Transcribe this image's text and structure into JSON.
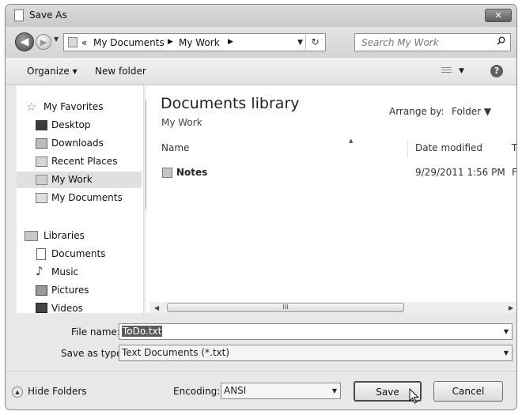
{
  "window": {
    "title": "Save As",
    "close_label": "✕"
  },
  "nav": {
    "back_label": "◀",
    "forward_label": "▶",
    "address": {
      "overflow": "«",
      "crumbs": [
        "My Documents",
        "My Work"
      ],
      "separator": "▶",
      "refresh": "↻"
    },
    "search_placeholder": "Search My Work"
  },
  "toolbar": {
    "organize": "Organize ▾",
    "new_folder": "New folder",
    "view_dd": "▼",
    "help": "?"
  },
  "sidebar": {
    "favorites": [
      {
        "label": "My Favorites",
        "icon": "star-icon"
      },
      {
        "label": "Desktop",
        "icon": "desktop-icon"
      },
      {
        "label": "Downloads",
        "icon": "downloads-icon"
      },
      {
        "label": "Recent Places",
        "icon": "recent-places-icon"
      },
      {
        "label": "My Work",
        "icon": "folder-icon",
        "selected": true
      },
      {
        "label": "My Documents",
        "icon": "documents-icon"
      }
    ],
    "libraries": [
      {
        "label": "Libraries",
        "icon": "libraries-icon"
      },
      {
        "label": "Documents",
        "icon": "document-icon"
      },
      {
        "label": "Music",
        "icon": "music-icon"
      },
      {
        "label": "Pictures",
        "icon": "pictures-icon"
      },
      {
        "label": "Videos",
        "icon": "videos-icon"
      }
    ],
    "scroll_up": "▲",
    "scroll_grip": "≡",
    "scroll_down": "▼"
  },
  "content": {
    "library_title": "Documents library",
    "library_subtitle": "My Work",
    "arrange_label": "Arrange by:",
    "arrange_value": "Folder ▼",
    "columns": [
      "Name",
      "Date modified",
      "T"
    ],
    "sort_indicator": "▲",
    "rows": [
      {
        "name": "Notes",
        "date": "9/29/2011 1:56 PM",
        "extra": "F"
      }
    ],
    "hscroll_left": "◀",
    "hscroll_grip": "III",
    "hscroll_right": "▶"
  },
  "form": {
    "file_name_label": "File name:",
    "file_name_value": "ToDo.txt",
    "save_type_label": "Save as type:",
    "save_type_value": "Text Documents (*.txt)",
    "dd_arrow": "▼"
  },
  "footer": {
    "hide_folders": "Hide Folders",
    "hide_icon": "▲",
    "encoding_label": "Encoding:",
    "encoding_value": "ANSI",
    "save_button": "Save",
    "cancel_button": "Cancel"
  }
}
